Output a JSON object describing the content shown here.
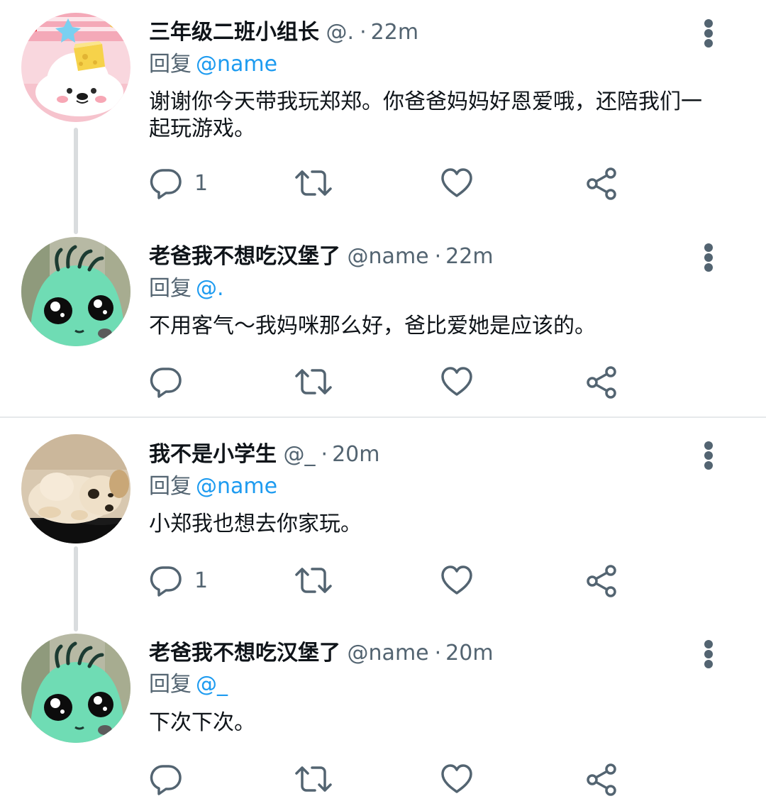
{
  "tweets": [
    {
      "display_name": "三年级二班小组长",
      "handle": "@.",
      "dot": "·",
      "time": "22m",
      "reply_label": "回复",
      "reply_to": "@name",
      "text": "谢谢你今天带我玩郑郑。你爸爸妈妈好恩爱哦，还陪我们一起玩游戏。",
      "reply_count": "1",
      "avatar": "seal-avatar"
    },
    {
      "display_name": "老爸我不想吃汉堡了",
      "handle": "@name",
      "dot": "·",
      "time": "22m",
      "reply_label": "回复",
      "reply_to": "@.",
      "text": "不用客气～我妈咪那么好，爸比爱她是应该的。",
      "reply_count": "",
      "avatar": "green-creature-avatar"
    },
    {
      "display_name": "我不是小学生",
      "handle": "@_",
      "dot": "·",
      "time": "20m",
      "reply_label": "回复",
      "reply_to": "@name",
      "text": "小郑我也想去你家玩。",
      "reply_count": "1",
      "avatar": "puppy-avatar"
    },
    {
      "display_name": "老爸我不想吃汉堡了",
      "handle": "@name",
      "dot": "·",
      "time": "20m",
      "reply_label": "回复",
      "reply_to": "@_",
      "text": "下次下次。",
      "reply_count": "",
      "avatar": "green-creature-avatar"
    }
  ],
  "icons": {
    "reply": "reply-icon",
    "retweet": "retweet-icon",
    "like": "like-icon",
    "share": "share-icon",
    "more": "more-vertical-icon"
  },
  "colors": {
    "text": "#0f1419",
    "secondary": "#536471",
    "mention": "#1d9bf0",
    "thread_line": "#d9dcde",
    "divider": "#e6e9eb"
  }
}
